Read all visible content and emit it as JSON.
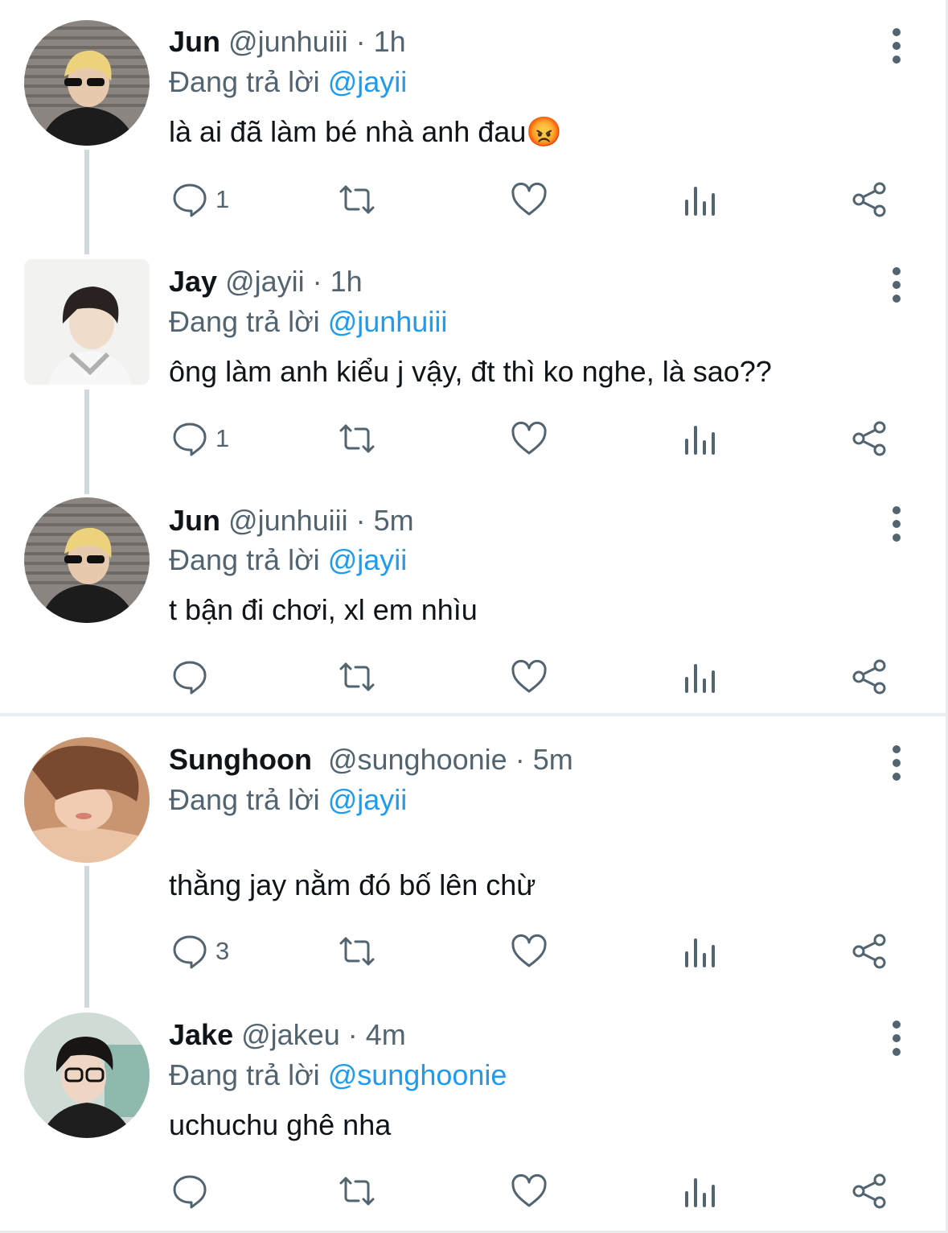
{
  "colors": {
    "accent": "#1d9bf0",
    "muted": "#536471",
    "text": "#0f1419",
    "thread": "#cfd9de"
  },
  "tweets": [
    {
      "name": "Jun",
      "handle": "@junhuiii",
      "time": "· 1h",
      "reply_prefix": "Đang trả lời",
      "reply_to": "@jayii",
      "text": "là ai đã làm bé nhà anh đau😡",
      "reply_count": "1",
      "avatar_icon": "avatar-jun"
    },
    {
      "name": "Jay",
      "handle": "@jayii",
      "time": "· 1h",
      "reply_prefix": "Đang trả lời",
      "reply_to": "@junhuiii",
      "text": "ông làm anh kiểu j vậy, đt thì ko nghe, là sao??",
      "reply_count": "1",
      "avatar_icon": "avatar-jay"
    },
    {
      "name": "Jun",
      "handle": "@junhuiii",
      "time": "· 5m",
      "reply_prefix": "Đang trả lời",
      "reply_to": "@jayii",
      "text": "t bận đi chơi, xl em nhìu",
      "reply_count": "",
      "avatar_icon": "avatar-jun"
    },
    {
      "name": "Sunghoon",
      "handle": "@sunghoonie",
      "time": "· 5m",
      "reply_prefix": "Đang trả lời",
      "reply_to": "@jayii",
      "text": "thằng jay nằm đó bố lên chừ",
      "reply_count": "3",
      "avatar_icon": "avatar-sunghoon"
    },
    {
      "name": "Jake",
      "handle": "@jakeu",
      "time": "· 4m",
      "reply_prefix": "Đang trả lời",
      "reply_to": "@sunghoonie",
      "text": "uchuchu ghê nha",
      "reply_count": "",
      "avatar_icon": "avatar-jake"
    }
  ],
  "action_icons": [
    "reply-icon",
    "retweet-icon",
    "like-icon",
    "views-icon",
    "share-icon"
  ]
}
